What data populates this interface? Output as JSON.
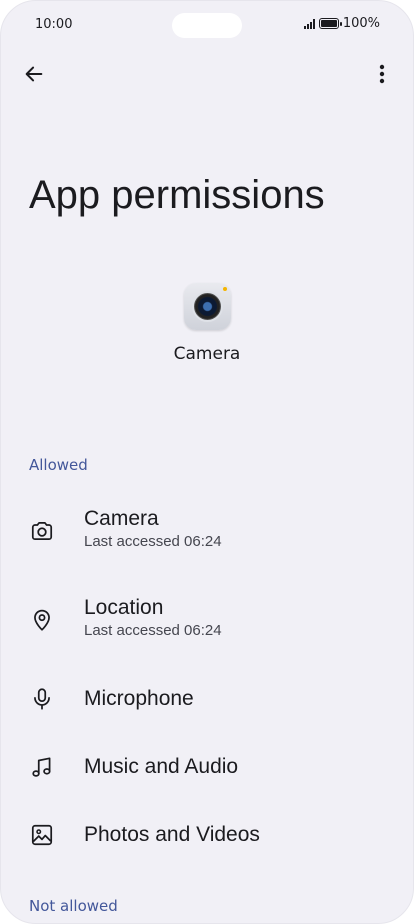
{
  "status_bar": {
    "time": "10:00",
    "battery": "100%"
  },
  "header": {
    "title": "App permissions"
  },
  "app": {
    "name": "Camera"
  },
  "allowed": {
    "title": "Allowed",
    "items": [
      {
        "label": "Camera",
        "sub": "Last accessed 06:24",
        "icon": "camera-icon"
      },
      {
        "label": "Location",
        "sub": "Last accessed 06:24",
        "icon": "location-pin-icon"
      },
      {
        "label": "Microphone",
        "icon": "microphone-icon"
      },
      {
        "label": "Music and Audio",
        "icon": "music-note-icon"
      },
      {
        "label": "Photos and Videos",
        "icon": "image-icon"
      }
    ]
  },
  "not_allowed": {
    "title": "Not allowed"
  },
  "colors": {
    "background": "#f1f0f6",
    "section_header": "#43579a",
    "text": "#1b1b1f"
  }
}
